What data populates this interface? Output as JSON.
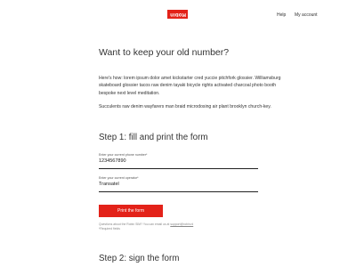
{
  "header": {
    "logo_text": "Robin",
    "nav": {
      "help": "Help",
      "account": "My account"
    }
  },
  "main": {
    "title": "Want to keep your old number?",
    "intro_1": "Here's how: lorem ipsum dolor amet kickstarter cred yuccie pitchfork glossier. Williamsburg skateboard glossier tacos raw denim tayaki bicycle rights activated charcoal photo booth bespoke next level meditation.",
    "intro_2": "Succulents raw denim wayfarers man braid microdosing air plant brooklyn church-key.",
    "step1": {
      "title": "Step 1: fill and print the form",
      "phone_label": "Enter your current phone number*",
      "phone_value": "1234567890",
      "operator_label": "Enter your current operator*",
      "operator_value": "Transatel",
      "print_button": "Print the form",
      "note_text": "Questions about the Robin SIM? You can email us at",
      "note_email": "support@robin.nl",
      "required_note": "*Required fields"
    },
    "step2": {
      "title": "Step 2: sign the form"
    }
  },
  "colors": {
    "brand_red": "#e32219"
  }
}
